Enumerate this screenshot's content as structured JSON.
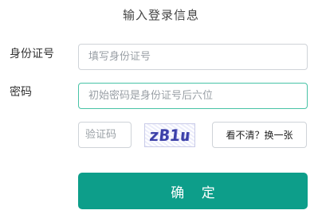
{
  "title": "输入登录信息",
  "form": {
    "id_label": "身份证号",
    "id_placeholder": "填写身份证号",
    "id_value": "",
    "password_label": "密码",
    "password_placeholder": "初始密码是身份证号后六位",
    "password_value": "",
    "captcha_placeholder": "验证码",
    "captcha_value": "",
    "captcha_text": "zB1u",
    "refresh_label": "看不清？换一张",
    "submit_label": "确 定"
  },
  "colors": {
    "accent": "#0d9e8a",
    "focus_border": "#48c3a6",
    "captcha_text": "#3b3fa6"
  }
}
